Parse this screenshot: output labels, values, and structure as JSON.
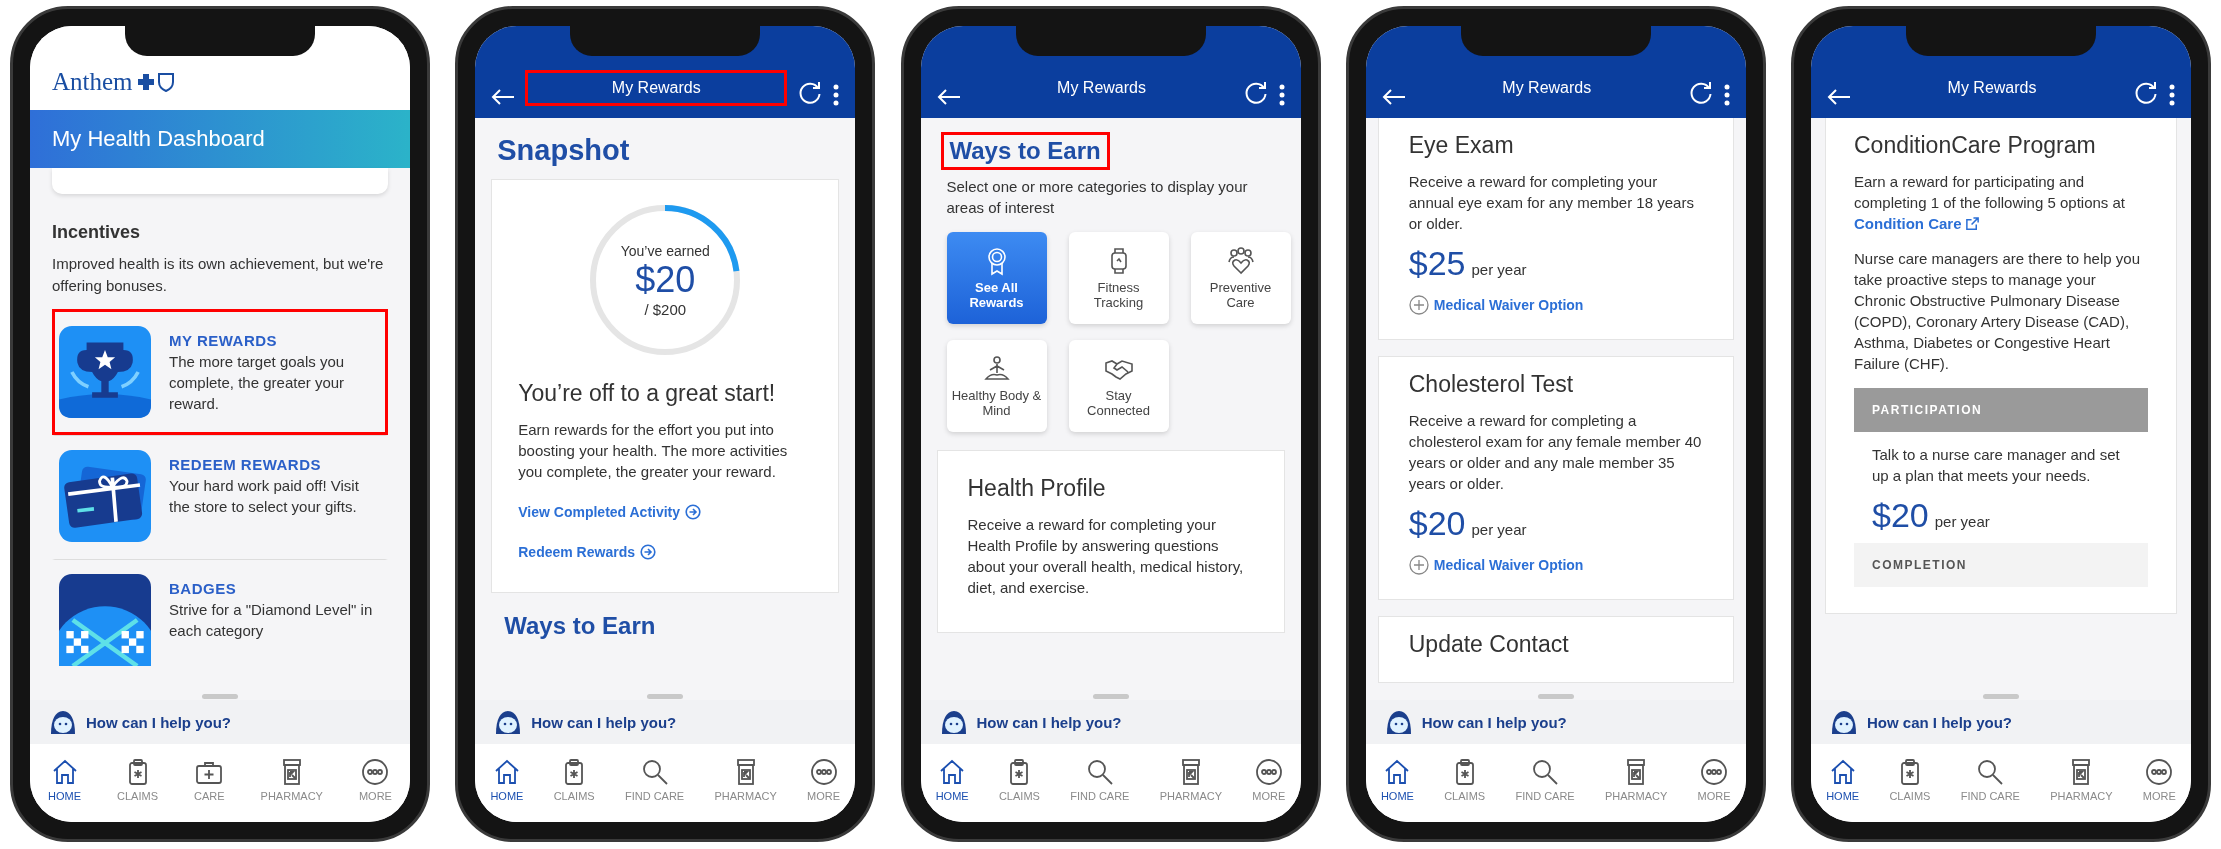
{
  "phones": [
    {
      "kind": "dashboard",
      "brand": "Anthem",
      "banner": "My Health Dashboard",
      "section_title": "Incentives",
      "section_text": "Improved health is its own achievement, but we're offering bonuses.",
      "items": [
        {
          "kind": "trophy",
          "title": "MY REWARDS",
          "text": "The more target goals you complete, the greater your reward.",
          "highlighted": true
        },
        {
          "kind": "gift_card",
          "title": "REDEEM REWARDS",
          "text": "Your hard work paid off! Visit the store to select your gifts.",
          "highlighted": false
        },
        {
          "kind": "flags",
          "title": "BADGES",
          "text": "Strive for a \"Diamond Level\" in each category",
          "highlighted": false
        }
      ],
      "assistant": "How can I help you?",
      "nav": [
        {
          "kind": "home",
          "label": "HOME",
          "selected": true
        },
        {
          "kind": "claims",
          "label": "CLAIMS",
          "selected": false
        },
        {
          "kind": "care",
          "label": "CARE",
          "selected": false
        },
        {
          "kind": "pharmacy",
          "label": "PHARMACY",
          "selected": false
        },
        {
          "kind": "more",
          "label": "MORE",
          "selected": false
        }
      ]
    },
    {
      "kind": "snapshot",
      "header": {
        "title": "My Rewards",
        "highlighted": true
      },
      "heading": "Snapshot",
      "card": {
        "level": 0.23,
        "label": "You’ve earned",
        "amount": "$20",
        "total": "/ $200",
        "title": "You’re off to a great start!",
        "text": "Earn rewards for the effort you put into boosting your health. The more activities you complete, the greater your reward.",
        "links": [
          "View Completed Activity",
          "Redeem Rewards"
        ]
      },
      "next_heading": "Ways to Earn",
      "assistant": "How can I help you?",
      "nav": [
        {
          "kind": "home",
          "label": "HOME",
          "selected": true
        },
        {
          "kind": "claims",
          "label": "CLAIMS",
          "selected": false
        },
        {
          "kind": "find_care",
          "label": "FIND CARE",
          "selected": false
        },
        {
          "kind": "pharmacy",
          "label": "PHARMACY",
          "selected": false
        },
        {
          "kind": "more",
          "label": "MORE",
          "selected": false
        }
      ]
    },
    {
      "kind": "ways",
      "header": {
        "title": "My Rewards",
        "highlighted": false
      },
      "heading": "Ways to Earn",
      "heading_highlighted": true,
      "text": "Select one or more categories to display your areas of interest",
      "categories": [
        {
          "kind": "ribbon",
          "label": "See All Rewards",
          "selected": true
        },
        {
          "kind": "watch",
          "label": "Fitness Tracking",
          "selected": false
        },
        {
          "kind": "people",
          "label": "Preventive Care",
          "selected": false
        },
        {
          "kind": "meditation",
          "label": "Healthy Body & Mind",
          "selected": false
        },
        {
          "kind": "handshake",
          "label": "Stay Connected",
          "selected": false
        }
      ],
      "card": {
        "title": "Health Profile",
        "text": "Receive a reward for completing your Health Profile by answering questions about your overall health, medical history, diet, and exercise."
      },
      "assistant": "How can I help you?",
      "nav": [
        {
          "kind": "home",
          "label": "HOME",
          "selected": true
        },
        {
          "kind": "claims",
          "label": "CLAIMS",
          "selected": false
        },
        {
          "kind": "find_care",
          "label": "FIND CARE",
          "selected": false
        },
        {
          "kind": "pharmacy",
          "label": "PHARMACY",
          "selected": false
        },
        {
          "kind": "more",
          "label": "MORE",
          "selected": false
        }
      ]
    },
    {
      "kind": "list",
      "header": {
        "title": "My Rewards",
        "highlighted": false
      },
      "cards": [
        {
          "title": "Eye Exam",
          "text": "Receive a reward for completing your annual eye exam for any member 18 years or older.",
          "amount": "$25",
          "unit": "per year",
          "link": "Medical Waiver Option"
        },
        {
          "title": "Cholesterol Test",
          "text": "Receive a reward for completing a cholesterol exam for any female member 40 years or older and any male member 35 years or older.",
          "amount": "$20",
          "unit": "per year",
          "link": "Medical Waiver Option"
        },
        {
          "title": "Update Contact"
        }
      ],
      "assistant": "How can I help you?",
      "nav": [
        {
          "kind": "home",
          "label": "HOME",
          "selected": true
        },
        {
          "kind": "claims",
          "label": "CLAIMS",
          "selected": false
        },
        {
          "kind": "find_care",
          "label": "FIND CARE",
          "selected": false
        },
        {
          "kind": "pharmacy",
          "label": "PHARMACY",
          "selected": false
        },
        {
          "kind": "more",
          "label": "MORE",
          "selected": false
        }
      ]
    },
    {
      "kind": "program",
      "header": {
        "title": "My Rewards",
        "highlighted": false
      },
      "card": {
        "title": "ConditionCare Program",
        "intro": "Earn a reward for participating and completing 1 of the following 5 options at",
        "link": "Condition Care",
        "text": "Nurse care managers are there to help you take proactive steps to manage your Chronic Obstructive Pulmonary Disease (COPD), Coronary Artery Disease (CAD), Asthma, Diabetes or Congestive Heart Failure (CHF).",
        "sections": [
          {
            "kind": "dark",
            "label": "PARTICIPATION",
            "text": "Talk to a nurse care manager and set up a plan that meets your needs.",
            "amount": "$20",
            "unit": "per year"
          },
          {
            "kind": "light",
            "label": "COMPLETION"
          }
        ]
      },
      "assistant": "How can I help you?",
      "nav": [
        {
          "kind": "home",
          "label": "HOME",
          "selected": true
        },
        {
          "kind": "claims",
          "label": "CLAIMS",
          "selected": false
        },
        {
          "kind": "find_care",
          "label": "FIND CARE",
          "selected": false
        },
        {
          "kind": "pharmacy",
          "label": "PHARMACY",
          "selected": false
        },
        {
          "kind": "more",
          "label": "MORE",
          "selected": false
        }
      ]
    }
  ]
}
